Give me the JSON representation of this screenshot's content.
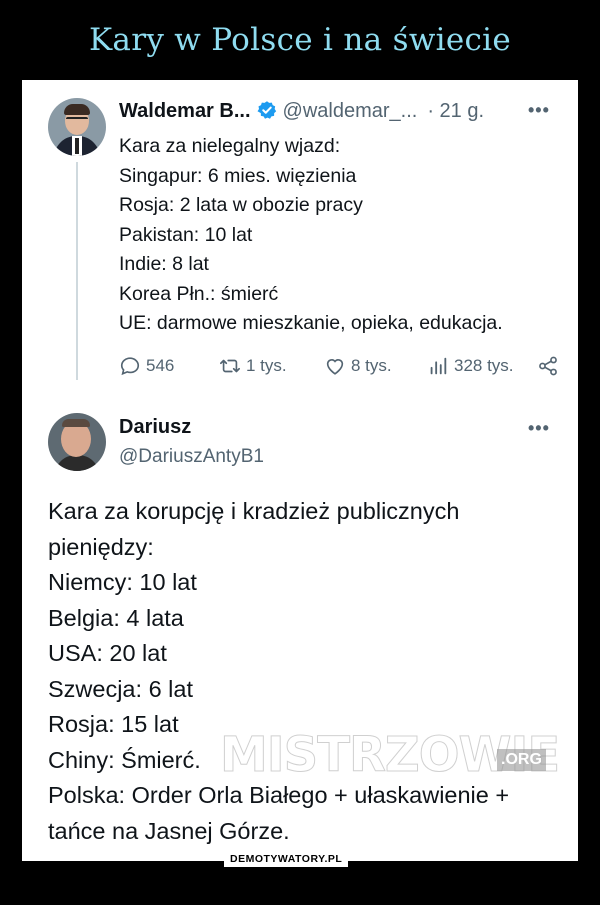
{
  "page": {
    "title": "Kary w Polsce i na świecie"
  },
  "tweet1": {
    "author_name": "Waldemar B...",
    "author_handle": "@waldemar_...",
    "time": "· 21 g.",
    "more": "•••",
    "lines": [
      "Kara za nielegalny wjazd:",
      "Singapur: 6 mies. więzienia",
      "Rosja: 2 lata w obozie pracy",
      "Pakistan: 10 lat",
      "Indie: 8 lat",
      "Korea Płn.: śmierć",
      "UE: darmowe mieszkanie, opieka, edukacja."
    ],
    "stats": {
      "replies": "546",
      "retweets": "1 tys.",
      "likes": "8 tys.",
      "views": "328 tys."
    }
  },
  "tweet2": {
    "author_name": "Dariusz",
    "author_handle": "@DariuszAntyB1",
    "more": "•••",
    "lines": [
      "Kara za korupcję i kradzież publicznych",
      "pieniędzy:",
      "Niemcy: 10 lat",
      "Belgia: 4 lata",
      "USA: 20 lat",
      "Szwecja: 6 lat",
      "Rosja: 15 lat",
      "Chiny: Śmierć.",
      "Polska: Order Orla Białego + ułaskawienie +",
      "tańce na Jasnej Górze."
    ]
  },
  "watermarks": {
    "main": "MISTRZOWIE",
    "org": ".ORG",
    "demot": "DEMOTYWATORY.PL"
  },
  "colors": {
    "title": "#8fdcf0",
    "verified": "#1d9bf0",
    "secondary_text": "#536471"
  }
}
